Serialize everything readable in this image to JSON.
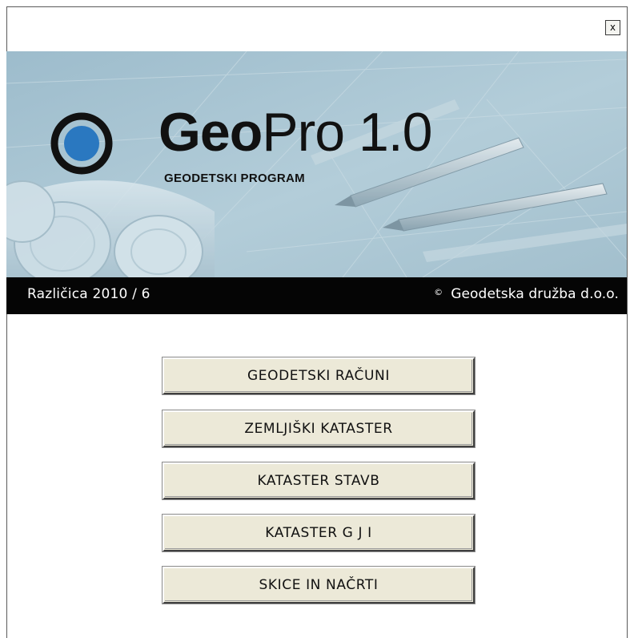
{
  "window": {
    "close_label": "x"
  },
  "banner": {
    "brand_bold": "Geo",
    "brand_light": "Pro 1.0",
    "subtitle": "GEODETSKI PROGRAM"
  },
  "footer": {
    "version": "Različica 2010 / 6",
    "copyright_symbol": "©",
    "copyright_text": "Geodetska družba d.o.o."
  },
  "menu": {
    "items": [
      {
        "label": "GEODETSKI RAČUNI"
      },
      {
        "label": "ZEMLJIŠKI KATASTER"
      },
      {
        "label": "KATASTER STAVB"
      },
      {
        "label": "KATASTER G J I"
      },
      {
        "label": "SKICE IN NAČRTI"
      }
    ]
  },
  "colors": {
    "banner_bg": "#a8c4d2",
    "logo_blue": "#2a78c0",
    "footer_bg": "#050505",
    "button_face": "#ece9d8"
  }
}
